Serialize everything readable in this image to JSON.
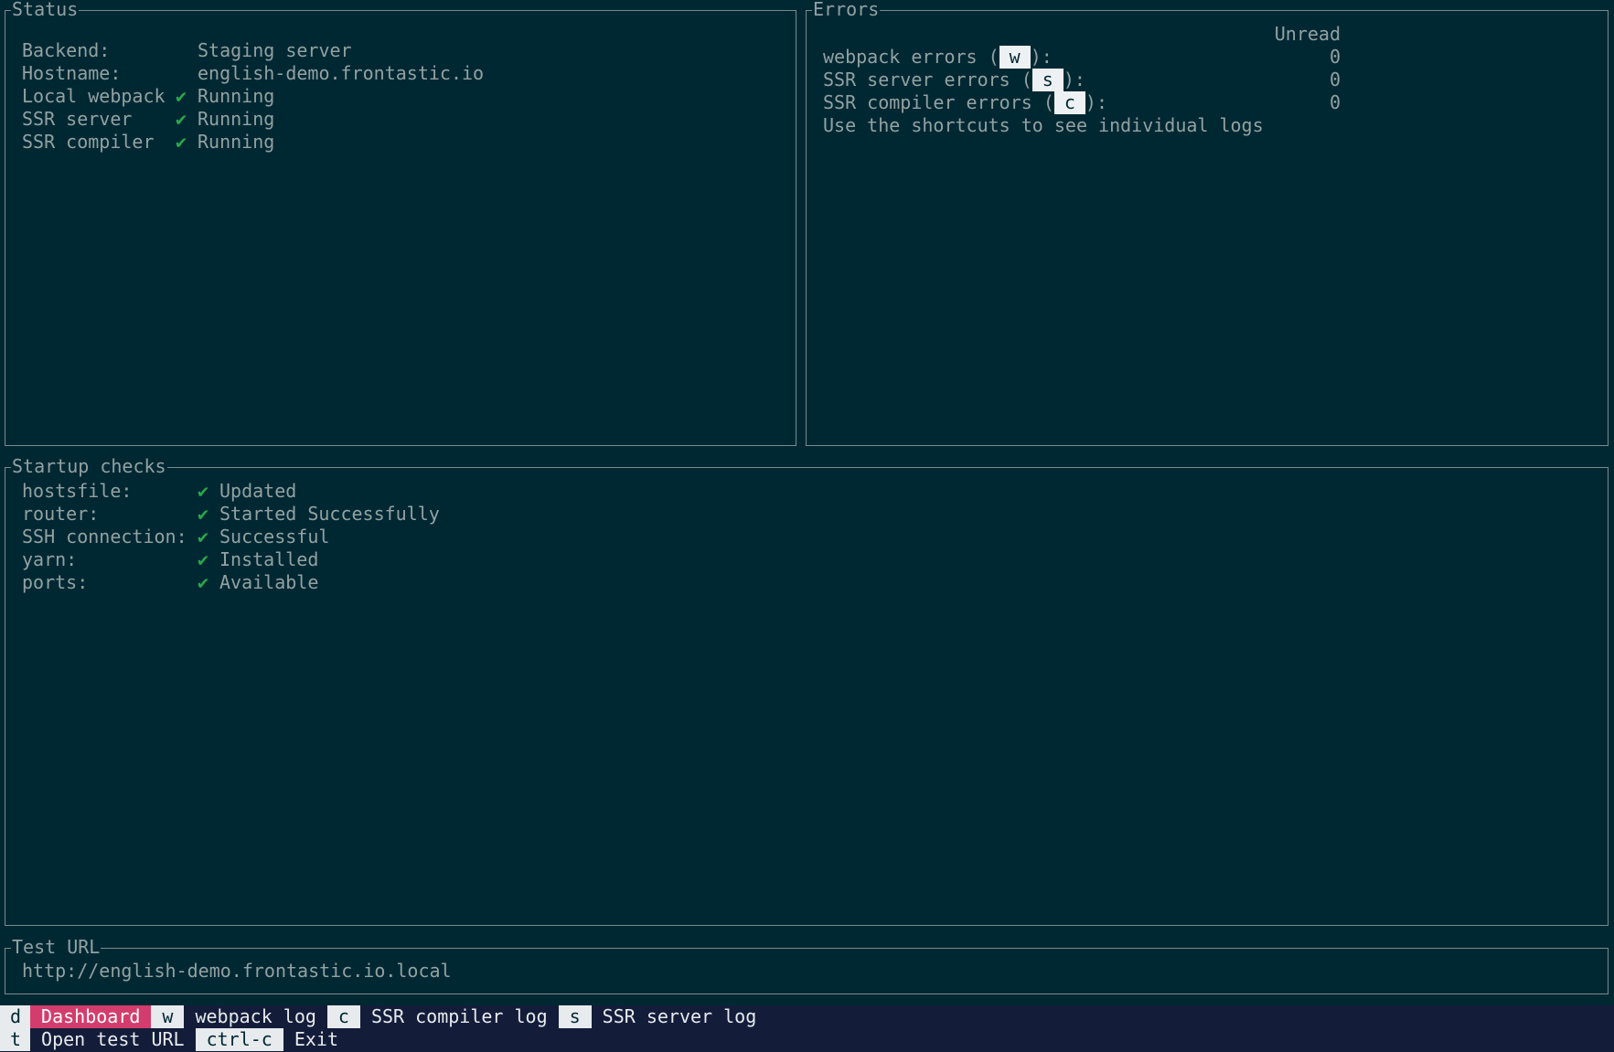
{
  "status": {
    "title": "Status",
    "rows": [
      {
        "label": "Backend:",
        "check": "",
        "value": "Staging server"
      },
      {
        "label": "Hostname:",
        "check": "",
        "value": "english-demo.frontastic.io"
      },
      {
        "label": "Local webpack",
        "check": "✔",
        "value": "Running"
      },
      {
        "label": "SSR server",
        "check": "✔",
        "value": "Running"
      },
      {
        "label": "SSR compiler",
        "check": "✔",
        "value": "Running"
      }
    ]
  },
  "errors": {
    "title": "Errors",
    "column_header": "Unread",
    "rows": [
      {
        "label": "webpack errors",
        "key": "w",
        "count": "0"
      },
      {
        "label": "SSR server errors",
        "key": "s",
        "count": "0"
      },
      {
        "label": "SSR compiler errors",
        "key": "c",
        "count": "0"
      }
    ],
    "hint": "Use the shortcuts to see individual logs"
  },
  "startup": {
    "title": "Startup checks",
    "rows": [
      {
        "label": "hostsfile:",
        "check": "✔",
        "value": "Updated"
      },
      {
        "label": "router:",
        "check": "✔",
        "value": "Started Successfully"
      },
      {
        "label": "SSH connection:",
        "check": "✔",
        "value": "Successful"
      },
      {
        "label": "yarn:",
        "check": "✔",
        "value": "Installed"
      },
      {
        "label": "ports:",
        "check": "✔",
        "value": "Available"
      }
    ]
  },
  "test_url": {
    "title": "Test URL",
    "url": "http://english-demo.frontastic.io.local"
  },
  "footer": {
    "line1": [
      {
        "key": "d",
        "label": "Dashboard",
        "active": true
      },
      {
        "key": "w",
        "label": "webpack log",
        "active": false
      },
      {
        "key": "c",
        "label": "SSR compiler log",
        "active": false
      },
      {
        "key": "s",
        "label": "SSR server log",
        "active": false
      }
    ],
    "line2": [
      {
        "key": "t",
        "label": "Open test URL",
        "active": false
      },
      {
        "key": "ctrl-c",
        "label": "Exit",
        "active": false
      }
    ]
  },
  "colors": {
    "background": "#002833",
    "text": "#93a1a1",
    "check": "#2aa84a",
    "active_tab": "#d33d6d",
    "footer_bg": "#131d3a"
  }
}
